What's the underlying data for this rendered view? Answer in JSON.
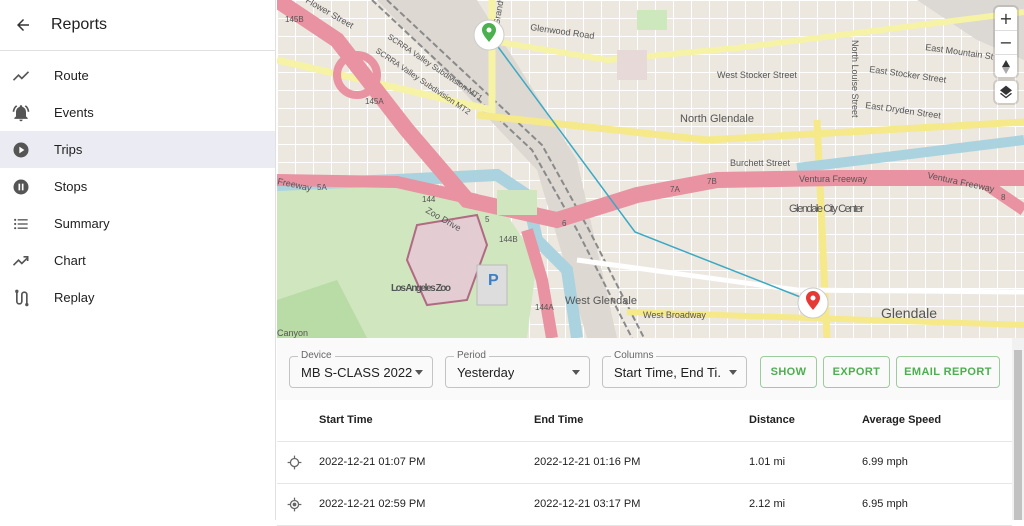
{
  "sidebar": {
    "title": "Reports",
    "back_icon": "arrow-back-icon",
    "items": [
      {
        "label": "Route",
        "icon": "timeline-icon"
      },
      {
        "label": "Events",
        "icon": "notifications-active-icon"
      },
      {
        "label": "Trips",
        "icon": "play-circle-icon",
        "active": true
      },
      {
        "label": "Stops",
        "icon": "pause-circle-icon"
      },
      {
        "label": "Summary",
        "icon": "format-list-bulleted-icon"
      },
      {
        "label": "Chart",
        "icon": "trending-up-icon"
      },
      {
        "label": "Replay",
        "icon": "route-icon"
      }
    ]
  },
  "map": {
    "labels": {
      "glenwood_road": "Glenwood Road",
      "west_stocker": "West Stocker Street",
      "east_stocker": "East Stocker Street",
      "east_mountain": "East Mountain St",
      "east_dryden": "East Dryden Street",
      "north_louise": "North Louise Street",
      "north_glendale": "North Glendale",
      "burchett": "Burchett Street",
      "ventura_1": "Ventura Freeway",
      "ventura_2": "Ventura Freeway",
      "glendale_city_center": "Glendale City Center",
      "la_zoo": "Los Angeles Zoo",
      "zoo_drive": "Zoo Drive",
      "west_glendale": "West Glendale",
      "west_broadway": "West Broadway",
      "glendale": "Glendale",
      "freeway": "Freeway",
      "canyon": "Canyon",
      "scrra_1": "SCRRA Valley Subdivision MT1",
      "scrra_2": "SCRRA Valley Subdivision MT2",
      "flower_street": "Flower Street",
      "grandview": "Grandview",
      "parking": "P",
      "shield_145b": "145B",
      "shield_145a": "145A",
      "shield_144": "144",
      "shield_144b": "144B",
      "shield_144a": "144A",
      "shield_5": "5",
      "shield_5a": "5A",
      "shield_6": "6",
      "shield_7a": "7A",
      "shield_7b": "7B",
      "shield_8": "8"
    },
    "controls": {
      "zoom_in": "+",
      "zoom_out": "−",
      "compass_icon": "compass-icon",
      "layers_icon": "layers-icon"
    },
    "colors": {
      "route_line": "#3ba9c4",
      "start_marker": "#4caf50",
      "end_marker": "#e53935",
      "motorway": "#e892a2",
      "water": "#aad3df"
    }
  },
  "filters": {
    "device": {
      "label": "Device",
      "value": "MB S-CLASS 2022"
    },
    "period": {
      "label": "Period",
      "value": "Yesterday"
    },
    "columns": {
      "label": "Columns",
      "value": "Start Time, End Ti..."
    }
  },
  "actions": {
    "show": "SHOW",
    "export": "EXPORT",
    "email": "EMAIL REPORT"
  },
  "table": {
    "headers": [
      "Start Time",
      "End Time",
      "Distance",
      "Average Speed"
    ],
    "rows": [
      {
        "icon": "gps-not-fixed-icon",
        "start": "2022-12-21 01:07 PM",
        "end": "2022-12-21 01:16 PM",
        "distance": "1.01 mi",
        "speed": "6.99 mph"
      },
      {
        "icon": "gps-fixed-icon",
        "start": "2022-12-21 02:59 PM",
        "end": "2022-12-21 03:17 PM",
        "distance": "2.12 mi",
        "speed": "6.95 mph"
      }
    ]
  }
}
